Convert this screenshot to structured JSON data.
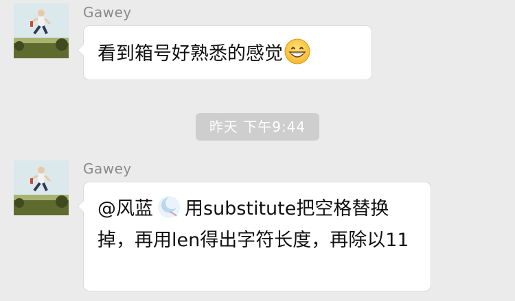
{
  "messages": [
    {
      "sender": "Gawey",
      "avatar": "child-jumping-photo-avatar",
      "text": "看到箱号好熟悉的感觉",
      "trailing_emoji": "grinning-face-emoji"
    },
    {
      "sender": "Gawey",
      "avatar": "child-jumping-photo-avatar",
      "mention": "@风蓝",
      "mention_avatar": "blue-moon-avatar-icon",
      "text": "用substitute把空格替换掉，再用len得出字符长度，再除以11"
    }
  ],
  "timestamp": {
    "label": "昨天 下午9:44"
  },
  "colors": {
    "background": "#EBEBEB",
    "bubble": "#FFFFFF",
    "bubble_border": "#DADADA",
    "sender_text": "#8A8A8A",
    "timestamp_bg": "#CECECE",
    "timestamp_text": "#FFFFFF"
  }
}
